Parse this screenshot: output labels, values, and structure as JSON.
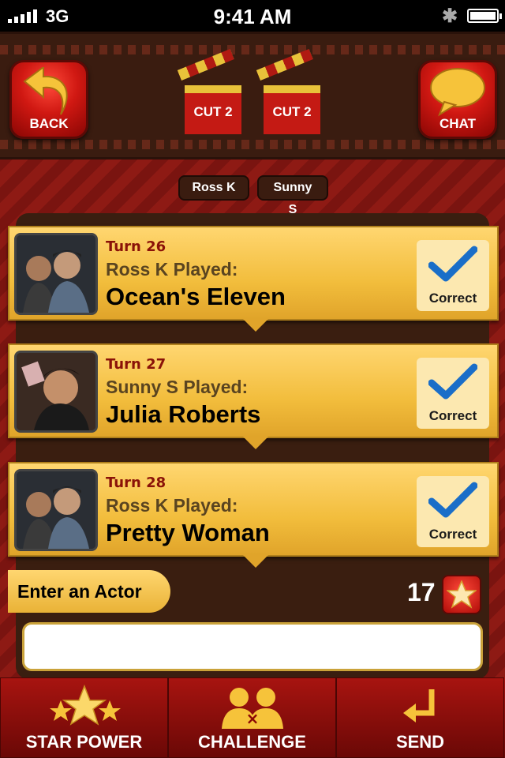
{
  "status_bar": {
    "carrier": "3G",
    "time": "9:41 AM"
  },
  "header": {
    "back_label": "BACK",
    "chat_label": "CHAT",
    "cuts": [
      "CUT 2",
      "CUT 2"
    ]
  },
  "players": [
    "Ross K",
    "Sunny S"
  ],
  "turns": [
    {
      "turn": "Turn 26",
      "played": "Ross K Played:",
      "answer": "Ocean's Eleven",
      "status": "Correct"
    },
    {
      "turn": "Turn 27",
      "played": "Sunny S Played:",
      "answer": "Julia Roberts",
      "status": "Correct"
    },
    {
      "turn": "Turn 28",
      "played": "Ross K Played:",
      "answer": "Pretty Woman",
      "status": "Correct"
    }
  ],
  "entry": {
    "prompt": "Enter an Actor",
    "star_count": "17",
    "input_value": ""
  },
  "toolbar": {
    "star_power": "STAR POWER",
    "challenge": "CHALLENGE",
    "send": "SEND"
  },
  "colors": {
    "accent_red": "#c41a14",
    "card_gold": "#f2bd3c",
    "check_blue": "#1a6ec8"
  }
}
